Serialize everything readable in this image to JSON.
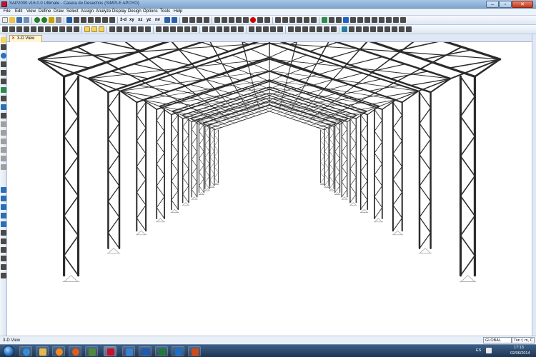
{
  "window": {
    "title": "SAP2000 v16.0.0 Ultimate - Caseta de Desechos  (SIMPLE APOYO)"
  },
  "menu": [
    "File",
    "Edit",
    "View",
    "Define",
    "Draw",
    "Select",
    "Assign",
    "Analyze",
    "Display",
    "Design",
    "Options",
    "Tools",
    "Help"
  ],
  "toolbar": {
    "view_buttons": [
      "3-d",
      "xy",
      "xz",
      "yz",
      "nv"
    ]
  },
  "view_tab": {
    "label": "3-D View"
  },
  "status": {
    "left_text": "3-D View",
    "coord_system": "GLOBAL",
    "units": "Ton f, m, C"
  },
  "taskbar": {
    "language": "ES",
    "time": "17:13",
    "date": "02/06/2014"
  },
  "colors": {
    "member": "#2b2b2b",
    "support": "#9a9a9a",
    "viewport_bg": "#ffffff",
    "tab_bg": "#fff6d5"
  },
  "icons": [
    "start-orb-icon",
    "internet-explorer-icon",
    "folder-icon",
    "media-player-icon",
    "firefox-icon",
    "photos-icon",
    "sap2000-icon",
    "network-icon",
    "word-icon",
    "excel-icon",
    "outlook-icon",
    "powerpoint-icon",
    "flag-icon"
  ]
}
